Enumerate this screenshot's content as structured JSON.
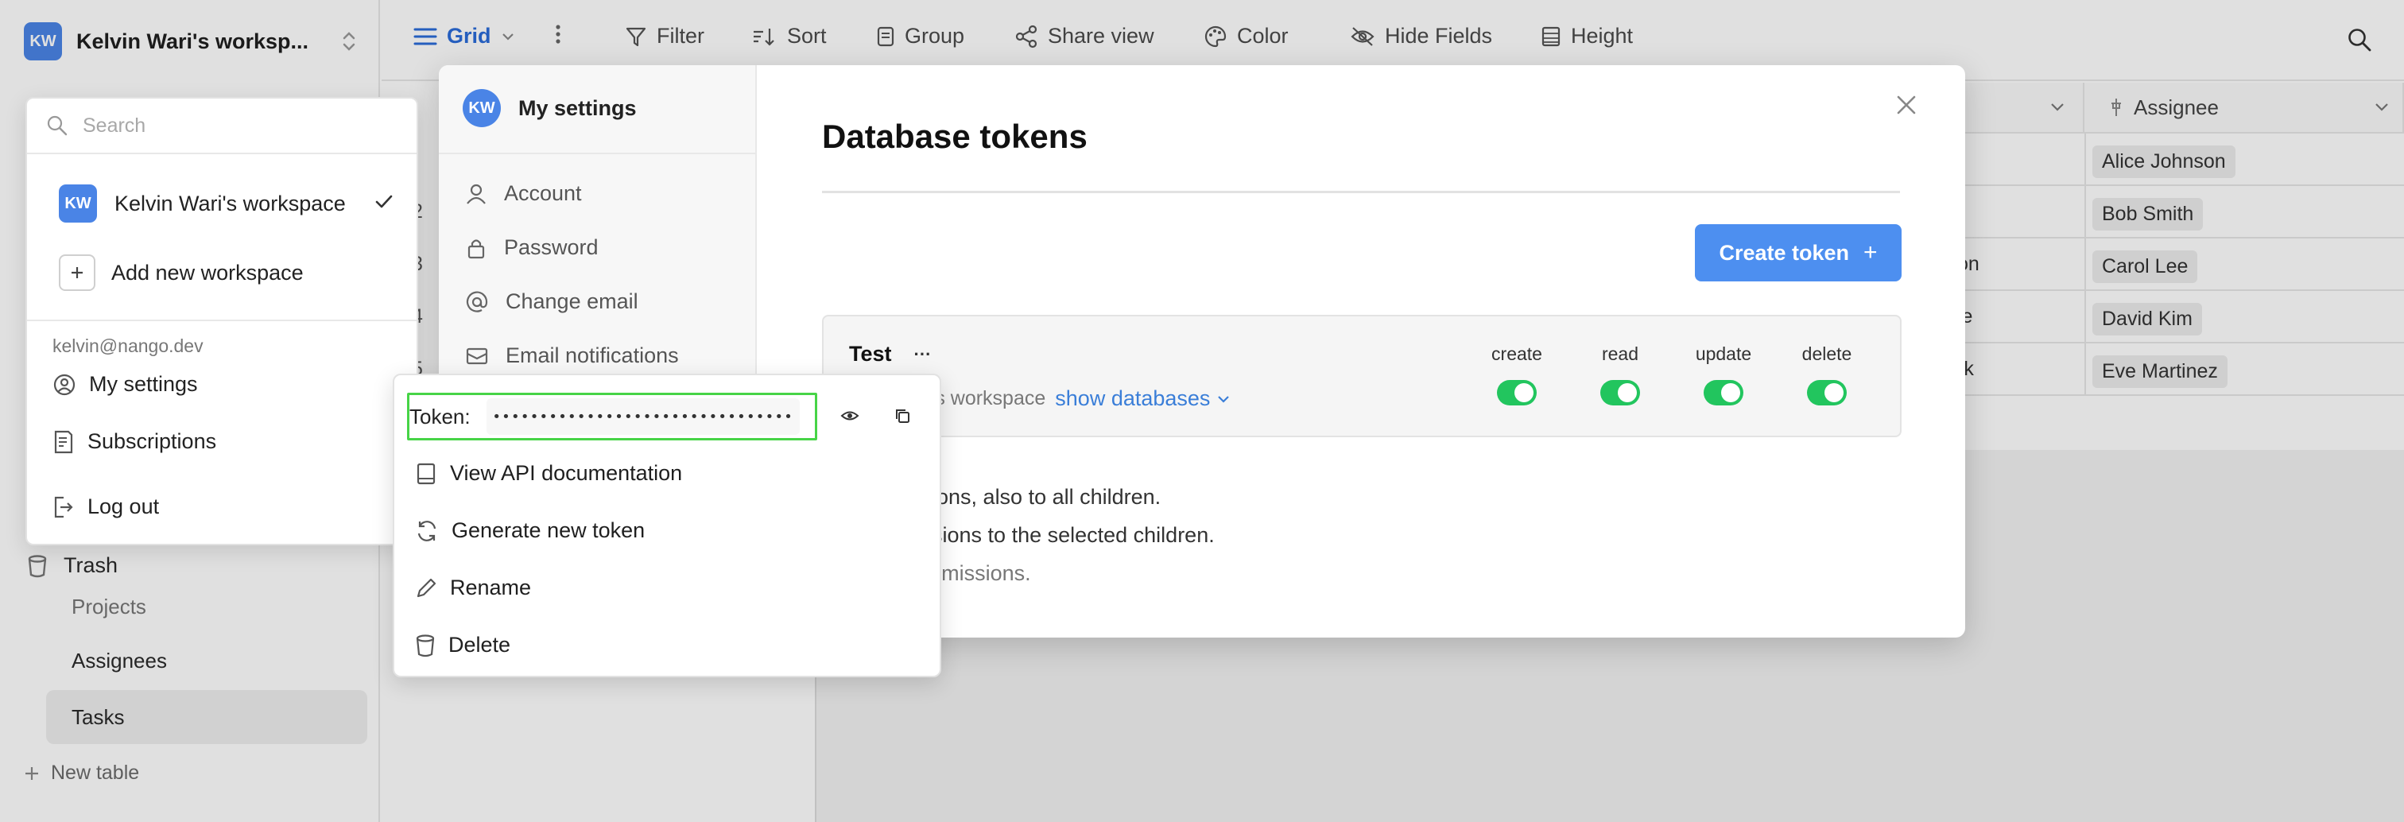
{
  "sidebar": {
    "workspace_initials": "KW",
    "workspace_name": "Kelvin Wari's worksp...",
    "trash_label": "Trash",
    "tables": [
      {
        "label": "Projects"
      },
      {
        "label": "Assignees"
      },
      {
        "label": "Tasks"
      }
    ],
    "new_table_label": "New table"
  },
  "toolbar": {
    "view_label": "Grid",
    "filter_label": "Filter",
    "sort_label": "Sort",
    "group_label": "Group",
    "share_label": "Share view",
    "color_label": "Color",
    "hide_fields_label": "Hide Fields",
    "height_label": "Height"
  },
  "grid": {
    "assignee_header": "Assignee",
    "row_numbers": [
      "2",
      "3",
      "4",
      "5"
    ],
    "partial_cells": [
      "on",
      "le",
      "rk"
    ],
    "assignees": [
      "Alice Johnson",
      "Bob Smith",
      "Carol Lee",
      "David Kim",
      "Eve Martinez"
    ]
  },
  "settings": {
    "avatar_initials": "KW",
    "title": "My settings",
    "nav": [
      {
        "label": "Account",
        "icon": "user-icon"
      },
      {
        "label": "Password",
        "icon": "lock-icon"
      },
      {
        "label": "Change email",
        "icon": "at-icon"
      },
      {
        "label": "Email notifications",
        "icon": "mail-icon"
      }
    ],
    "page_title": "Database tokens",
    "create_button": "Create token",
    "create_button_icon": "+",
    "token": {
      "name": "Test",
      "menu_glyph": "···",
      "workspace_text": "i's workspace",
      "show_databases": "show databases",
      "permissions": [
        "create",
        "read",
        "update",
        "delete"
      ],
      "permission_states": [
        true,
        true,
        true,
        true
      ]
    },
    "permission_notes": [
      "l permissions, also to all children.",
      "ly permissions to the selected children.",
      "t have permissions."
    ]
  },
  "workspace_menu": {
    "search_placeholder": "Search",
    "workspace_initials": "KW",
    "workspace_name": "Kelvin Wari's workspace",
    "add_workspace": "Add new workspace",
    "email": "kelvin@nango.dev",
    "my_settings": "My settings",
    "subscriptions": "Subscriptions",
    "log_out": "Log out"
  },
  "token_menu": {
    "token_label": "Token:",
    "token_value": "••••••••••••••••••••••••••••••••",
    "view_api_docs": "View API documentation",
    "generate_new": "Generate new token",
    "rename": "Rename",
    "delete": "Delete"
  },
  "colors": {
    "accent": "#4d8ff0",
    "toggle_on": "#22c55e",
    "highlight_outline": "#47d447",
    "avatar": "#4a84e6"
  }
}
